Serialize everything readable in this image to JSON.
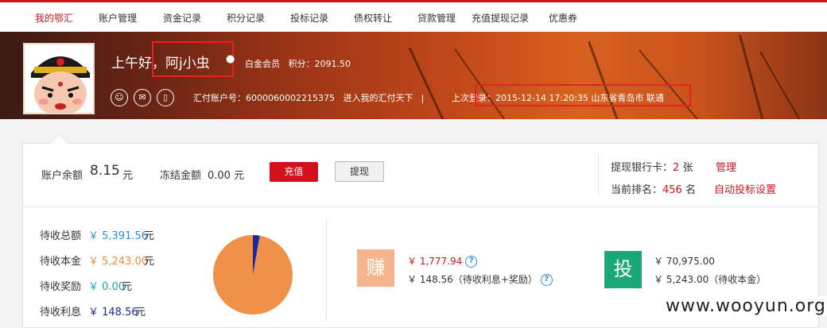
{
  "nav": {
    "items": [
      "我的鄂汇",
      "账户管理",
      "资金记录",
      "积分记录",
      "投标记录",
      "债权转让",
      "贷款管理",
      "充值提现记录",
      "优惠券"
    ]
  },
  "header": {
    "greeting": "上午好，阿j小虫",
    "member_level": "白金会员",
    "points_label": "积分：",
    "points": "2091.50",
    "account_label": "汇付账户号：",
    "account_no": "6000060002215375",
    "enter_link": "进入我的汇付天下",
    "divider": "|",
    "last_login_label": "上次登录：",
    "last_login": "2015-12-14 17:20:35 山东省青岛市 联通",
    "icons": [
      "user-icon",
      "mail-icon",
      "phone-icon"
    ]
  },
  "balance": {
    "label": "账户余额",
    "value": "8.15",
    "unit": "元",
    "frozen_label": "冻结金额",
    "frozen_value": "0.00 元",
    "recharge_btn": "充值",
    "withdraw_btn": "提现"
  },
  "bank": {
    "label": "提现银行卡：",
    "count": "2",
    "unit": "张",
    "manage_link": "管理",
    "rank_label": "当前排名：",
    "rank": "456",
    "rank_unit": "名",
    "auto_link": "自动投标设置"
  },
  "pending": {
    "rows": [
      {
        "label": "待收总额",
        "value": "￥ 5,391.56",
        "unit": "元",
        "color": "#2b8fd8"
      },
      {
        "label": "待收本金",
        "value": "￥ 5,243.00",
        "unit": "元",
        "color": "#ee8a3a"
      },
      {
        "label": "待收奖励",
        "value": "￥ 0.00",
        "unit": "元",
        "color": "#21a0b0"
      },
      {
        "label": "待收利息",
        "value": "￥ 148.56",
        "unit": "元",
        "color": "#1a2a8a"
      }
    ]
  },
  "chart_data": {
    "type": "pie",
    "slices": [
      {
        "value": 5243.0,
        "color": "#f0914a"
      },
      {
        "value": 148.56,
        "color": "#1a2a9a"
      },
      {
        "value": 0.0,
        "color": "#21a0b0"
      }
    ]
  },
  "earn": {
    "badge": "赚",
    "badge_color": "#f7b58e",
    "line1": "￥ 1,777.94",
    "line2": "￥ 148.56（待收利息+奖励）"
  },
  "invest": {
    "badge": "投",
    "badge_color": "#1aa876",
    "line1": "￥ 70,975.00",
    "line2": "￥ 5,243.00（待收本金）"
  },
  "watermark": "www.wooyun.org"
}
